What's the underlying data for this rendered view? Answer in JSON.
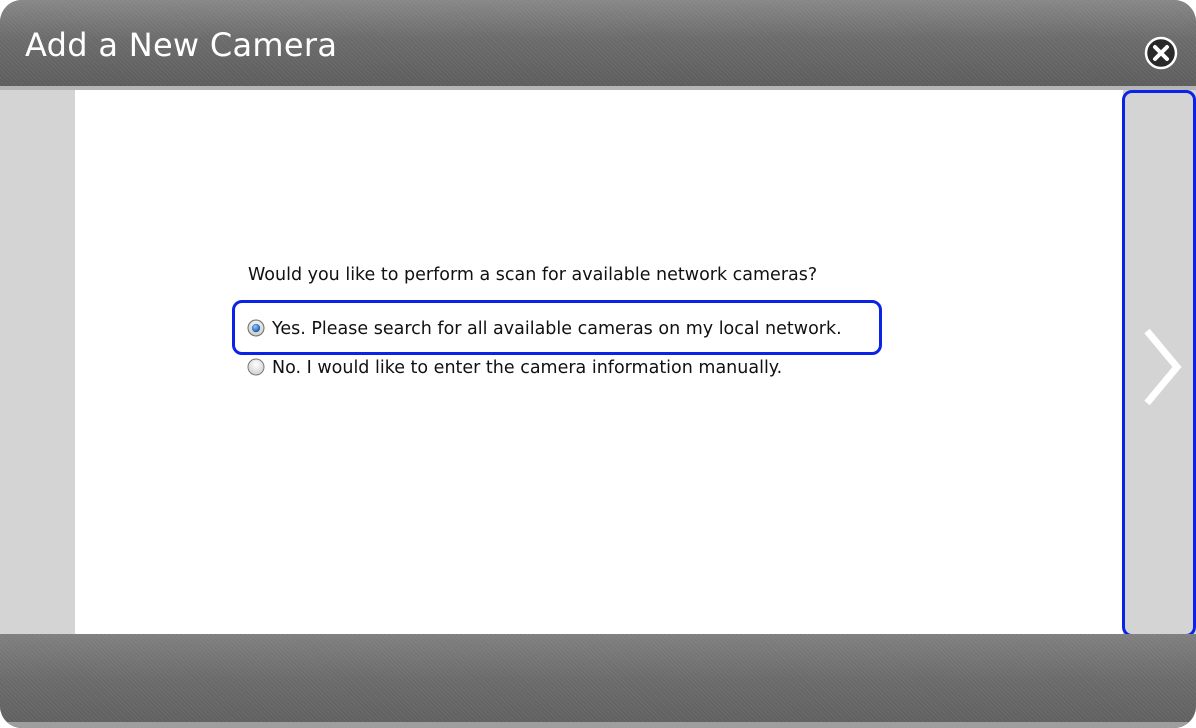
{
  "dialog": {
    "title": "Add a New Camera",
    "close_icon": "close-circle-x-icon",
    "next_icon": "chevron-right-icon"
  },
  "scan": {
    "question": "Would you like to perform a scan for available network cameras?",
    "options": [
      {
        "label": "Yes. Please search for all available cameras on my local network.",
        "selected": true
      },
      {
        "label": "No. I would like to enter the camera information manually.",
        "selected": false
      }
    ]
  },
  "colors": {
    "highlight": "#0a23e6",
    "radio_selected": "#1f6fd6",
    "title_text": "#ffffff"
  }
}
